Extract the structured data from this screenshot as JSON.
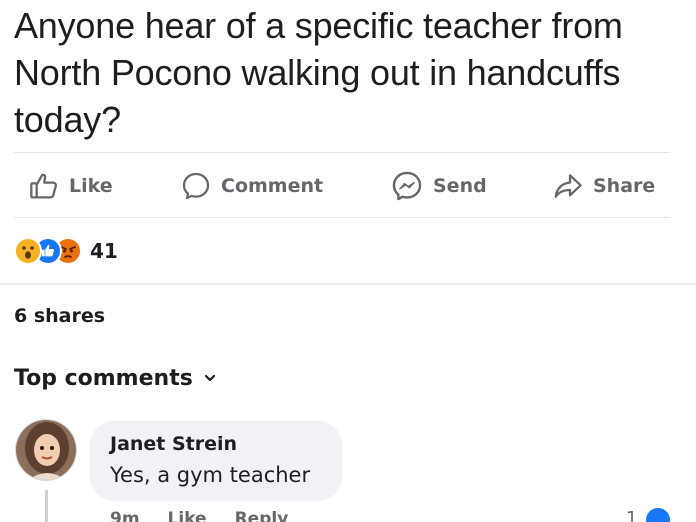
{
  "post": {
    "text": "Anyone hear of a specific teacher from North Pocono walking out in handcuffs today?"
  },
  "actions": {
    "like": "Like",
    "comment": "Comment",
    "send": "Send",
    "share": "Share"
  },
  "reactions": {
    "icons": [
      "wow-icon",
      "like-icon",
      "angry-icon"
    ],
    "count": "41"
  },
  "shares": "6 shares",
  "comments_header": "Top comments",
  "comment": {
    "author": "Janet Strein",
    "text": "Yes, a gym teacher",
    "time": "9m",
    "like": "Like",
    "reply": "Reply",
    "reaction_count": "1"
  },
  "colors": {
    "text": "#1c1e21",
    "secondary": "#65676b",
    "like_blue": "#1877f2",
    "wow_yellow": "#f7b125",
    "angry_red": "#e9710f",
    "bubble": "#f0f2f5"
  }
}
